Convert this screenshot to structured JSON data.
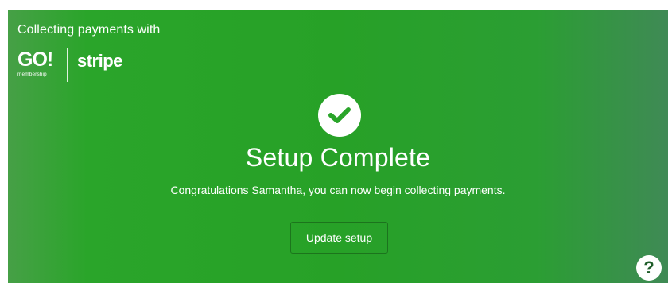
{
  "header": {
    "collecting_text": "Collecting payments with"
  },
  "logos": {
    "go_main": "GO!",
    "go_sub": "membership",
    "stripe": "stripe"
  },
  "status": {
    "icon": "check-circle-icon",
    "title": "Setup Complete",
    "message": "Congratulations Samantha, you can now begin collecting payments."
  },
  "actions": {
    "update_label": "Update setup"
  },
  "help": {
    "icon": "help-icon",
    "glyph": "?"
  },
  "colors": {
    "panel_green": "#27a127",
    "white": "#ffffff",
    "help_glyph": "#1f5d2a"
  }
}
